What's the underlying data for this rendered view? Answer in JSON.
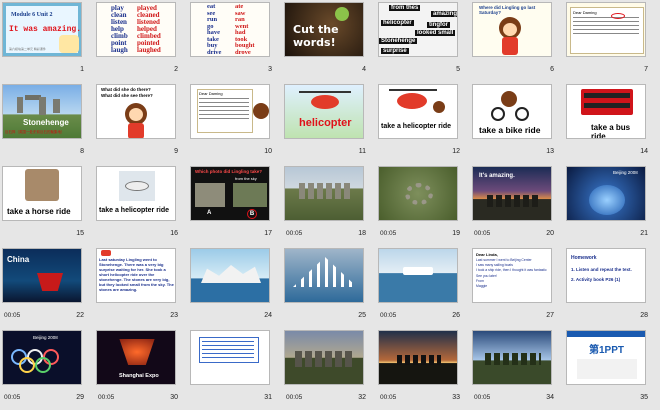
{
  "slides": [
    {
      "n": "1",
      "time": "",
      "lines": [
        "Module 6 Unit 2",
        "It was amazing.",
        "第六模块第二单元 精彩课件"
      ]
    },
    {
      "n": "2",
      "time": "",
      "col1": [
        "play",
        "clean",
        "listen",
        "help",
        "climb",
        "point",
        "laugh"
      ],
      "col2": [
        "played",
        "cleaned",
        "listened",
        "helped",
        "climbed",
        "pointed",
        "laughed"
      ]
    },
    {
      "n": "3",
      "time": "",
      "col1": [
        "eat",
        "see",
        "run",
        "go",
        "have",
        "take",
        "buy",
        "drive"
      ],
      "col2": [
        "ate",
        "saw",
        "ran",
        "went",
        "had",
        "took",
        "bought",
        "drove"
      ]
    },
    {
      "n": "4",
      "time": "",
      "title": "Cut the words!"
    },
    {
      "n": "5",
      "time": "",
      "tags": [
        "from thes",
        "amazing",
        "helicopter",
        "tingfor",
        "looked small",
        "Stonehenge",
        "surprise"
      ]
    },
    {
      "n": "6",
      "time": "",
      "title": "Where did Lingling go last Saturday?"
    },
    {
      "n": "7",
      "time": "",
      "title": "Dear Daming"
    },
    {
      "n": "8",
      "time": "",
      "caption": "Stonehenge",
      "sub": "巨石阵（英国一处史前巨石的聚集地）"
    },
    {
      "n": "9",
      "time": "",
      "q1": "What did she do there?",
      "q2": "What did she see there?"
    },
    {
      "n": "10",
      "time": "",
      "title": "Dear Daming"
    },
    {
      "n": "11",
      "time": "",
      "caption": "helicopter"
    },
    {
      "n": "12",
      "time": "",
      "caption": "take a helicopter ride"
    },
    {
      "n": "13",
      "time": "",
      "caption": "take a bike ride"
    },
    {
      "n": "14",
      "time": "",
      "caption": "take a bus ride"
    },
    {
      "n": "15",
      "time": "",
      "caption": "take a horse ride"
    },
    {
      "n": "16",
      "time": "",
      "caption": "take a helicopter ride"
    },
    {
      "n": "17",
      "time": "",
      "title": "Which photo did Lingling take?",
      "sub": "from the sky",
      "optA": "A",
      "optB": "B"
    },
    {
      "n": "18",
      "time": "00:05"
    },
    {
      "n": "19",
      "time": "00:05"
    },
    {
      "n": "20",
      "time": "00:05",
      "title": "It's amazing."
    },
    {
      "n": "21",
      "time": "",
      "title": "Beijing 2008"
    },
    {
      "n": "22",
      "time": "00:05",
      "title": "China"
    },
    {
      "n": "23",
      "time": "",
      "text": "Last saturday Lingling went to Stonehenge. There was a very big surprise waiting for her. She took a short helicopter ride over the stonehenge. The stones are very big, but they looked small from the sky. The stones are amazing."
    },
    {
      "n": "24",
      "time": ""
    },
    {
      "n": "25",
      "time": ""
    },
    {
      "n": "26",
      "time": "00:05"
    },
    {
      "n": "27",
      "time": "",
      "title": "Dear Linda,",
      "lines": [
        "Last summer I went to Beijing Center",
        "I saw many sailing boats",
        "I took a ship ride, then I thought it was fantastic",
        "See you later!",
        "From",
        "Maggie"
      ]
    },
    {
      "n": "28",
      "time": "",
      "title": "Homework",
      "lines": [
        "1. Listen and repeat the text.",
        "2. Activity book P26 (1)"
      ]
    },
    {
      "n": "29",
      "time": "00:05",
      "title": "Beijing 2008"
    },
    {
      "n": "30",
      "time": "00:05",
      "title": "Shanghai Expo"
    },
    {
      "n": "31",
      "time": ""
    },
    {
      "n": "32",
      "time": "00:05"
    },
    {
      "n": "33",
      "time": "00:05"
    },
    {
      "n": "34",
      "time": "00:05"
    },
    {
      "n": "35",
      "time": "",
      "title": "第1PPT"
    }
  ],
  "colors": {
    "accent_red": "#e0121a",
    "selected_bg": "#ffffff",
    "grid_bg": "#e6e6e6"
  }
}
